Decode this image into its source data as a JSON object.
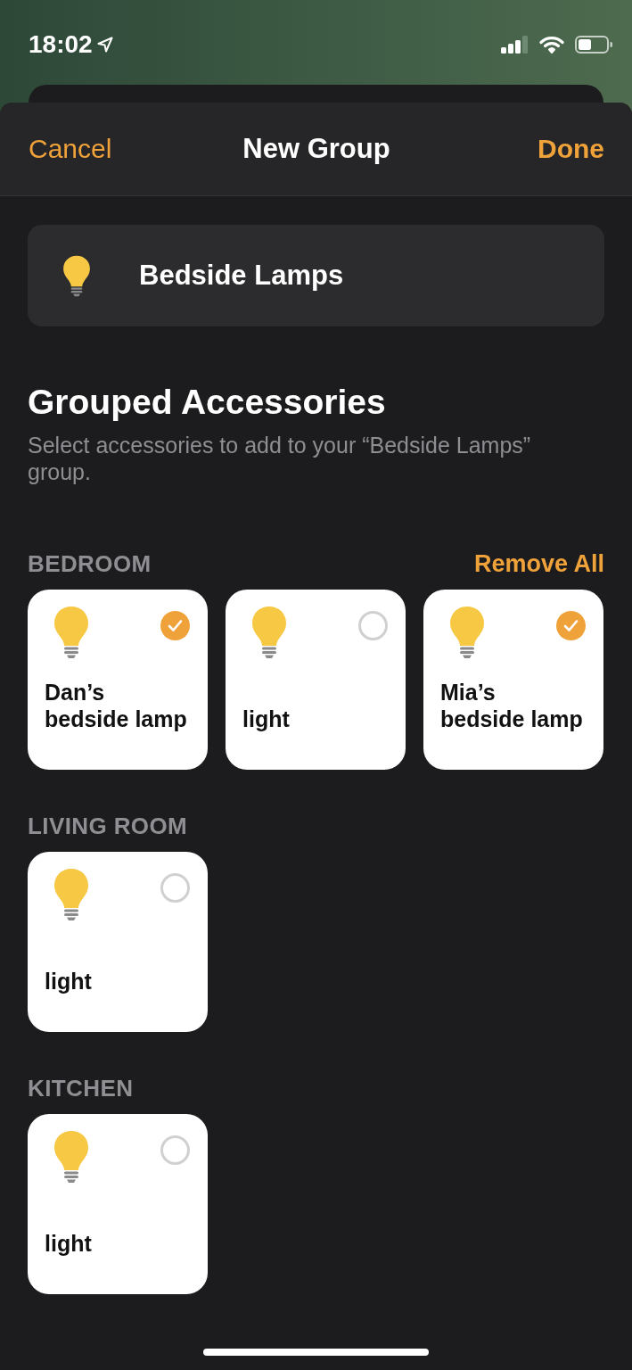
{
  "status_bar": {
    "time": "18:02"
  },
  "nav": {
    "cancel": "Cancel",
    "title": "New Group",
    "done": "Done"
  },
  "group_name": {
    "value": "Bedside Lamps"
  },
  "section": {
    "title": "Grouped Accessories",
    "description": "Select accessories to add to your “Bedside Lamps” group."
  },
  "rooms": [
    {
      "name": "BEDROOM",
      "action": "Remove All",
      "accessories": [
        {
          "name": "Dan’s bedside lamp",
          "selected": true
        },
        {
          "name": "light",
          "selected": false
        },
        {
          "name": "Mia’s bedside lamp",
          "selected": true
        }
      ]
    },
    {
      "name": "LIVING ROOM",
      "accessories": [
        {
          "name": "light",
          "selected": false
        }
      ]
    },
    {
      "name": "KITCHEN",
      "accessories": [
        {
          "name": "light",
          "selected": false
        }
      ]
    }
  ]
}
